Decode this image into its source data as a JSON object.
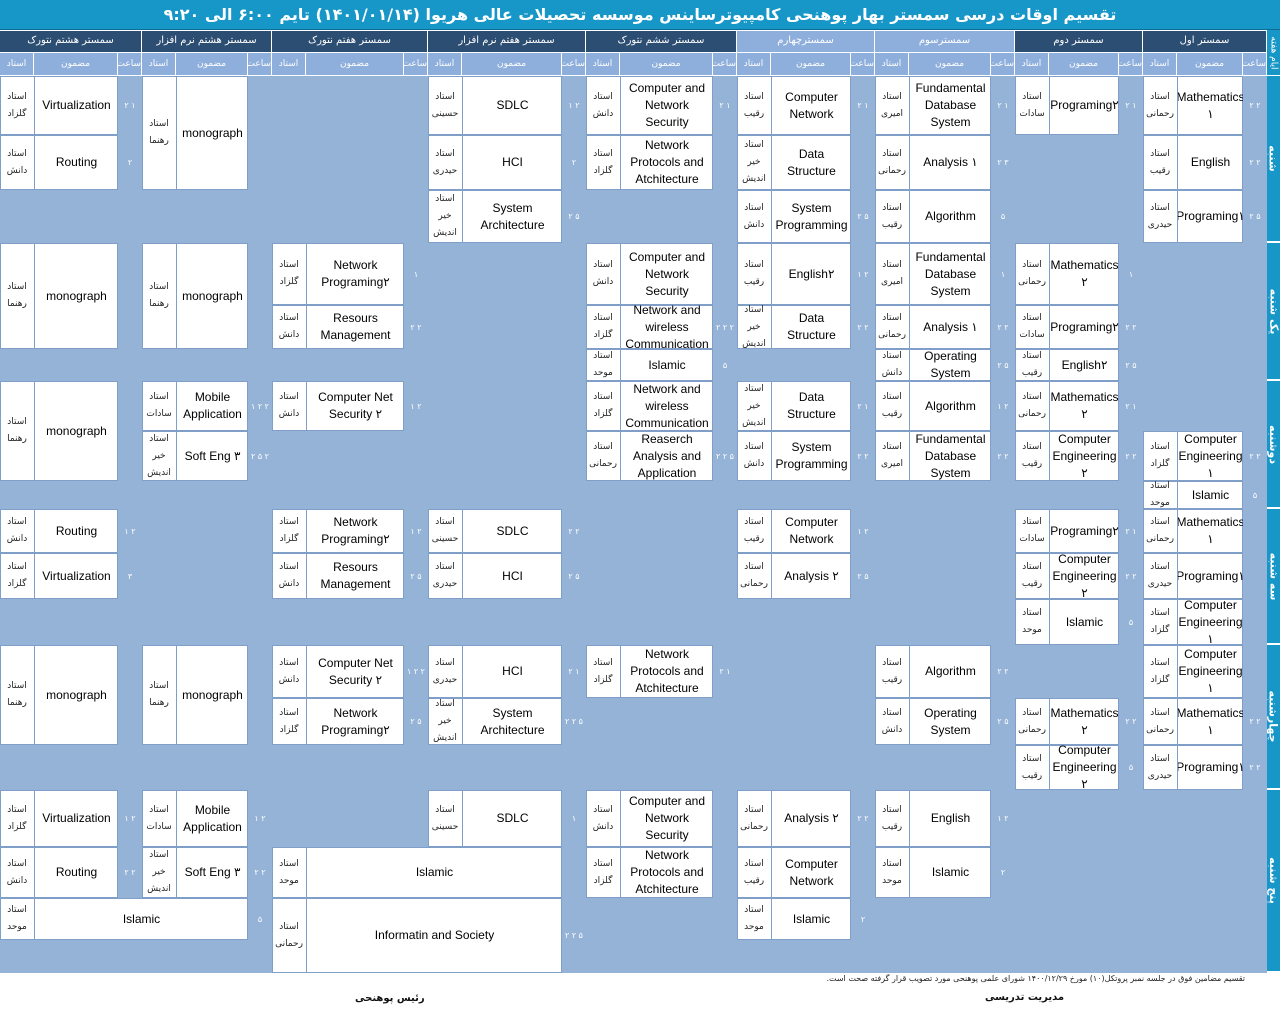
{
  "title": "تقسیم اوقات درسی سمستر بهار پوهنحی کامپیوترساینس موسسه تحصیلات عالی هریوا (۱۴۰۱/۰۱/۱۴) تایم ۶:۰۰ الی ۹:۲۰",
  "header": {
    "days_label": "ایام هفته",
    "semesters": [
      "سمستر اول",
      "سمستر دوم",
      "سمسترسوم",
      "سمسترچهارم",
      "سمستر ششم نتورک",
      "سمستر هفتم نرم افزار",
      "سمستر هفتم  نتورک",
      "سمستر هشتم نرم افزار",
      "سمستر هشتم نتورک"
    ],
    "sub_labels": {
      "time": "ساعت",
      "subject": "مضمون",
      "teacher": "استاد"
    }
  },
  "days": [
    "شنبه",
    "یک شنبه",
    "دوشنبه",
    "سه شنبه",
    "چهارشنبه",
    "پنج شنبه"
  ],
  "colors": {
    "title": "#1796c8",
    "header_dark": "#2c4e72",
    "header_light": "#8eaedb",
    "filler": "#95b3d7"
  },
  "cells": [
    {
      "subject": "Mathematics ۱",
      "teacher": "استاد رحمانی",
      "time": "۲ ۲"
    },
    {
      "subject": "English",
      "teacher": "استاد رقیب",
      "time": "۲ ۲"
    },
    {
      "subject": "Programing۱",
      "teacher": "استاد حیدری",
      "time": "۲ ۵"
    },
    {
      "subject": "Programing۲",
      "teacher": "استاد سادات",
      "time": "۲ ۱"
    },
    {
      "subject": "Fundamental Database System",
      "teacher": "استاد امیری",
      "time": "۲ ۱"
    },
    {
      "subject": "Analysis ۱",
      "teacher": "استاد رحمانی",
      "time": "۲ ۳"
    },
    {
      "subject": "Algorithm",
      "teacher": "استاد رقیب",
      "time": "۵"
    },
    {
      "subject": "Computer Network",
      "teacher": "استاد رقیب",
      "time": "۲ ۱"
    },
    {
      "subject": "Data Structure",
      "teacher": "استاد خیر اندیش",
      "time": ""
    },
    {
      "subject": "System Programming",
      "teacher": "استاد دانش",
      "time": "۲ ۵"
    },
    {
      "subject": "Computer and Network Security",
      "teacher": "استاد دانش",
      "time": "۲ ۱"
    },
    {
      "subject": "Network Protocols and Atchitecture",
      "teacher": "استاد گلزاد",
      "time": ""
    },
    {
      "subject": "SDLC",
      "teacher": "استاد حسینی",
      "time": "۱ ۲"
    },
    {
      "subject": "HCI",
      "teacher": "استاد حیدری",
      "time": "۲"
    },
    {
      "subject": "System Architecture",
      "teacher": "استاد خیر اندیش",
      "time": "۲ ۵"
    },
    {
      "subject": "monograph",
      "teacher": "استاد رهنما",
      "time": ""
    },
    {
      "subject": "Virtualization",
      "teacher": "استاد گلزاد",
      "time": "۲ ۱"
    },
    {
      "subject": "Routing",
      "teacher": "استاد دانش",
      "time": "۲"
    },
    {
      "subject": "Mathematics ۲",
      "teacher": "استاد رحمانی",
      "time": "۱"
    },
    {
      "subject": "Programing۲",
      "teacher": "استاد سادات",
      "time": "۲ ۲"
    },
    {
      "subject": "English۲",
      "teacher": "استاد رقیب",
      "time": "۲ ۵"
    },
    {
      "subject": "Fundamental Database System",
      "teacher": "استاد امیری",
      "time": "۱"
    },
    {
      "subject": "Analysis ۱",
      "teacher": "استاد رحمانی",
      "time": "۲ ۲"
    },
    {
      "subject": "Operating System",
      "teacher": "استاد دانش",
      "time": "۲ ۵"
    },
    {
      "subject": "English۲",
      "teacher": "استاد رقیب",
      "time": "۱ ۲"
    },
    {
      "subject": "Data Structure",
      "teacher": "استاد خیر اندیش",
      "time": "۲ ۲"
    },
    {
      "subject": "Computer and Network Security",
      "teacher": "استاد دانش",
      "time": ""
    },
    {
      "subject": "Network and wireless Communication",
      "teacher": "استاد گلزاد",
      "time": "۲ ۲ ۲"
    },
    {
      "subject": "Islamic",
      "teacher": "استاد موحد",
      "time": "۵"
    },
    {
      "subject": "Network Programing۲",
      "teacher": "استاد گلزاد",
      "time": "۱"
    },
    {
      "subject": "Resours Management",
      "teacher": "استاد دانش",
      "time": "۲ ۲"
    },
    {
      "subject": "monograph",
      "teacher": "استاد رهنما",
      "time": ""
    },
    {
      "subject": "monograph",
      "teacher": "استاد رهنما",
      "time": ""
    },
    {
      "subject": "Computer Engineering ۱",
      "teacher": "استاد گلزاد",
      "time": "۲ ۲"
    },
    {
      "subject": "Islamic",
      "teacher": "استاد موحد",
      "time": "۵"
    },
    {
      "subject": "Mathematics ۲",
      "teacher": "استاد رحمانی",
      "time": "۲ ۱"
    },
    {
      "subject": "Computer Engineering ۲",
      "teacher": "استاد رقیب",
      "time": "۲ ۲"
    },
    {
      "subject": "Algorithm",
      "teacher": "استاد رقیب",
      "time": "۱ ۲"
    },
    {
      "subject": "Fundamental Database System",
      "teacher": "استاد امیری",
      "time": "۲ ۲"
    },
    {
      "subject": "Data Structure",
      "teacher": "استاد خیر اندیش",
      "time": "۲ ۱"
    },
    {
      "subject": "System Programming",
      "teacher": "استاد دانش",
      "time": "۲ ۲"
    },
    {
      "subject": "Network and wireless Communication",
      "teacher": "استاد گلزاد",
      "time": ""
    },
    {
      "subject": "Reaserch Analysis and Application",
      "teacher": "استاد رحمانی",
      "time": "۲ ۲ ۵"
    },
    {
      "subject": "Computer Net Security ۲",
      "teacher": "استاد دانش",
      "time": "۱ ۲"
    },
    {
      "subject": "Mobile Application",
      "teacher": "استاد سادات",
      "time": "۱ ۲ ۲"
    },
    {
      "subject": "Soft Eng ۳",
      "teacher": "استاد خیر اندیش",
      "time": "۲ ۵ ۲"
    },
    {
      "subject": "monograph",
      "teacher": "استاد رهنما",
      "time": ""
    },
    {
      "subject": "Mathematics ۱",
      "teacher": "استاد رحمانی",
      "time": ""
    },
    {
      "subject": "Programing۱",
      "teacher": "استاد حیدری",
      "time": ""
    },
    {
      "subject": "Computer Engineering ۱",
      "teacher": "استاد گلزاد",
      "time": ""
    },
    {
      "subject": "Programing۲",
      "teacher": "استاد سادات",
      "time": "۲ ۱"
    },
    {
      "subject": "Computer Engineering ۲",
      "teacher": "استاد رقیب",
      "time": "۲ ۲"
    },
    {
      "subject": "Islamic",
      "teacher": "استاد موحد",
      "time": "۵"
    },
    {
      "subject": "Computer Network",
      "teacher": "استاد رقیب",
      "time": "۱ ۲"
    },
    {
      "subject": "Analysis ۲",
      "teacher": "استاد رحمانی",
      "time": "۲ ۵"
    },
    {
      "subject": "SDLC",
      "teacher": "استاد حسینی",
      "time": "۲ ۲"
    },
    {
      "subject": "HCI",
      "teacher": "استاد حیدری",
      "time": "۲ ۵"
    },
    {
      "subject": "Network Programing۲",
      "teacher": "استاد گلزاد",
      "time": "۱ ۲"
    },
    {
      "subject": "Resours Management",
      "teacher": "استاد دانش",
      "time": "۲ ۵"
    },
    {
      "subject": "Routing",
      "teacher": "استاد دانش",
      "time": "۱ ۲"
    },
    {
      "subject": "Virtualization",
      "teacher": "استاد گلزاد",
      "time": "۳"
    },
    {
      "subject": "Computer Engineering ۱",
      "teacher": "استاد گلزاد",
      "time": ""
    },
    {
      "subject": "Mathematics ۱",
      "teacher": "استاد رحمانی",
      "time": "۲ ۲"
    },
    {
      "subject": "Programing۱",
      "teacher": "استاد حیدری",
      "time": "۲ ۲"
    },
    {
      "subject": "Mathematics ۲",
      "teacher": "استاد رحمانی",
      "time": "۲ ۲"
    },
    {
      "subject": "Computer Engineering ۲",
      "teacher": "استاد رقیب",
      "time": "۵"
    },
    {
      "subject": "Algorithm",
      "teacher": "استاد رقیب",
      "time": "۲ ۲"
    },
    {
      "subject": "Operating System",
      "teacher": "استاد دانش",
      "time": "۲ ۵"
    },
    {
      "subject": "Network Protocols and Atchitecture",
      "teacher": "استاد گلزاد",
      "time": "۲ ۱"
    },
    {
      "subject": "HCI",
      "teacher": "استاد حیدری",
      "time": "۲ ۱"
    },
    {
      "subject": "System Architecture",
      "teacher": "استاد خیر اندیش",
      "time": "۲ ۲ ۵"
    },
    {
      "subject": "Computer Net Security ۲",
      "teacher": "استاد دانش",
      "time": "۱ ۲ ۲"
    },
    {
      "subject": "Network Programing۲",
      "teacher": "استاد گلزاد",
      "time": "۲ ۵"
    },
    {
      "subject": "monograph",
      "teacher": "استاد رهنما",
      "time": ""
    },
    {
      "subject": "monograph",
      "teacher": "استاد رهنما",
      "time": ""
    },
    {
      "subject": "English",
      "teacher": "استاد رقیب",
      "time": "۱ ۲"
    },
    {
      "subject": "Islamic",
      "teacher": "استاد موحد",
      "time": "۲"
    },
    {
      "subject": "Analysis ۲",
      "teacher": "استاد رحمانی",
      "time": "۲ ۲"
    },
    {
      "subject": "Computer Network",
      "teacher": "استاد رقیب",
      "time": ""
    },
    {
      "subject": "Islamic",
      "teacher": "استاد موحد",
      "time": "۲"
    },
    {
      "subject": "Computer and Network Security",
      "teacher": "استاد دانش",
      "time": ""
    },
    {
      "subject": "Network Protocols and Atchitecture",
      "teacher": "استاد گلزاد",
      "time": ""
    },
    {
      "subject": "SDLC",
      "teacher": "استاد حسینی",
      "time": "۱"
    },
    {
      "subject": "Islamic",
      "teacher": "استاد موحد",
      "time": ""
    },
    {
      "subject": "Informatin and Society",
      "teacher": "استاد رحمانی",
      "time": "۲ ۲ ۵"
    },
    {
      "subject": "Mobile Application",
      "teacher": "استاد سادات",
      "time": "۱ ۲"
    },
    {
      "subject": "Soft Eng ۳",
      "teacher": "استاد خیر اندیش",
      "time": "۲ ۲"
    },
    {
      "subject": "Virtualization",
      "teacher": "استاد گلزاد",
      "time": "۱ ۲"
    },
    {
      "subject": "Routing",
      "teacher": "استاد دانش",
      "time": "۲ ۲"
    },
    {
      "subject": "Islamic",
      "teacher": "استاد موحد",
      "time": "۵"
    }
  ],
  "footer": {
    "note": "تقسیم مضامین فوق در جلسه نمبر پروتکل(۱۰) مورخ ۱۴۰۰/۱۲/۲۹ شورای علمی پوهنحی مورد تصویب قرار گرفته صحت است.",
    "sig_left": "رئیس پوهنحی",
    "sig_right": "مدیریت تدریسی"
  }
}
